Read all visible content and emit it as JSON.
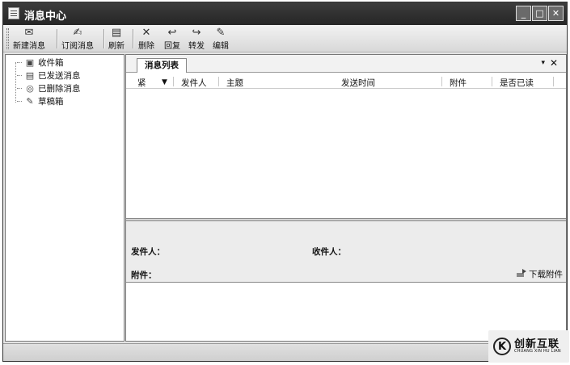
{
  "window": {
    "title": "消息中心",
    "controls": {
      "minimize": "_",
      "maximize": "□",
      "close": "✕"
    }
  },
  "toolbar": {
    "buttons": [
      {
        "label": "新建消息",
        "icon": "new-message-icon",
        "glyph": "✉"
      },
      {
        "label": "订阅消息",
        "icon": "subscribe-icon",
        "glyph": "✍"
      },
      {
        "label": "刷新",
        "icon": "refresh-icon",
        "glyph": "▤"
      },
      {
        "label": "删除",
        "icon": "delete-icon",
        "glyph": "✕"
      },
      {
        "label": "回复",
        "icon": "reply-icon",
        "glyph": "↩"
      },
      {
        "label": "转发",
        "icon": "forward-icon",
        "glyph": "↪"
      },
      {
        "label": "编辑",
        "icon": "edit-icon",
        "glyph": "✎"
      }
    ]
  },
  "sidebar": {
    "items": [
      {
        "label": "收件箱",
        "icon": "inbox-icon",
        "glyph": "▣"
      },
      {
        "label": "已发送消息",
        "icon": "sent-icon",
        "glyph": "▤"
      },
      {
        "label": "已删除消息",
        "icon": "trash-icon",
        "glyph": "◎"
      },
      {
        "label": "草稿箱",
        "icon": "drafts-icon",
        "glyph": "✎"
      }
    ]
  },
  "message_list": {
    "tab_label": "消息列表",
    "tab_menu": "▾",
    "tab_close": "✕",
    "sort_arrow": "▼",
    "columns": [
      "紧",
      "发件人",
      "主题",
      "发送时间",
      "附件",
      "是否已读"
    ]
  },
  "detail": {
    "from_label": "发件人：",
    "to_label": "收件人：",
    "attachment_label": "附件：",
    "download_label": "下载附件"
  },
  "watermark": {
    "logo_glyph": "K",
    "text": "创新互联",
    "subtext": "CHUANG XIN HU LIAN"
  }
}
